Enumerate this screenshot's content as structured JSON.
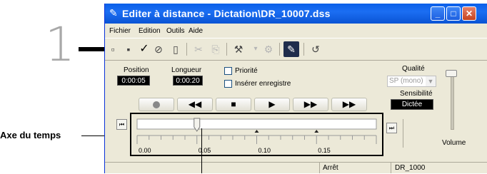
{
  "annotation": {
    "step_number": "1",
    "axis_caption": "Axe du temps"
  },
  "window": {
    "title": "Editer à distance - Dictation\\DR_10007.dss"
  },
  "menu": [
    "Fichier",
    "Edition",
    "Outils",
    "Aide"
  ],
  "toolbar": [
    "new-file-icon",
    "save-icon",
    "checkmark-icon",
    "verify-icon",
    "book-icon",
    "cut-icon",
    "copy-icon",
    "tools-icon",
    "settings-icon",
    "edit-mode-icon",
    "undo-icon"
  ],
  "position": {
    "label": "Position",
    "value": "0:00:05"
  },
  "length": {
    "label": "Longueur",
    "value": "0:00:20"
  },
  "priority": {
    "label": "Priorité"
  },
  "insert": {
    "label": "Insérer enregistre"
  },
  "quality": {
    "label": "Qualité",
    "value": "SP (mono)"
  },
  "sensitivity": {
    "label": "Sensibilité",
    "value": "Dictée"
  },
  "volume": {
    "label": "Volume"
  },
  "transport": [
    "record-button",
    "rewind-button",
    "stop-button",
    "play-button",
    "fast-forward-button",
    "skip-end-button"
  ],
  "timeline": {
    "ticks": [
      "0.00",
      "0.05",
      "0.10",
      "0.15"
    ],
    "position_fraction": 0.25
  },
  "status": {
    "state": "Arrêt",
    "file": "DR_1000"
  }
}
